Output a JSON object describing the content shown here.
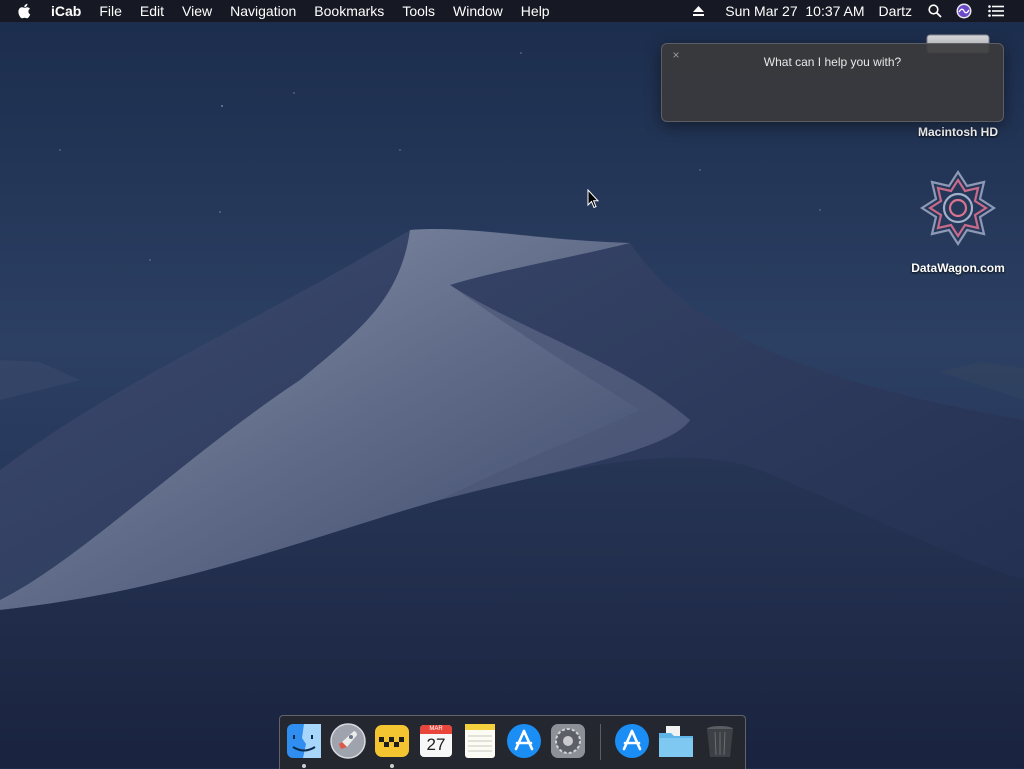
{
  "menubar": {
    "app_name": "iCab",
    "menus": [
      "File",
      "Edit",
      "View",
      "Navigation",
      "Bookmarks",
      "Tools",
      "Window",
      "Help"
    ],
    "datetime": "Sun Mar 27  10:37 AM",
    "user": "Dartz"
  },
  "siri": {
    "prompt": "What can I help you with?",
    "close_glyph": "×"
  },
  "desktop": {
    "icons": [
      {
        "label": "Macintosh HD"
      },
      {
        "label": "DataWagon.com"
      }
    ]
  },
  "dock": {
    "apps": [
      {
        "name": "Finder",
        "running": true
      },
      {
        "name": "Launchpad",
        "running": false
      },
      {
        "name": "iCab",
        "running": true
      },
      {
        "name": "Calendar",
        "running": false,
        "month": "MAR",
        "day": "27"
      },
      {
        "name": "Notes",
        "running": false
      },
      {
        "name": "App Store",
        "running": false
      },
      {
        "name": "System Preferences",
        "running": false
      },
      {
        "name": "App Store Downloads",
        "running": false
      },
      {
        "name": "Documents",
        "running": false
      },
      {
        "name": "Trash",
        "running": false
      }
    ]
  },
  "colors": {
    "menubar_bg": "#16181f",
    "sky_top": "#1a2a4a",
    "dune": "#8a93ab"
  }
}
